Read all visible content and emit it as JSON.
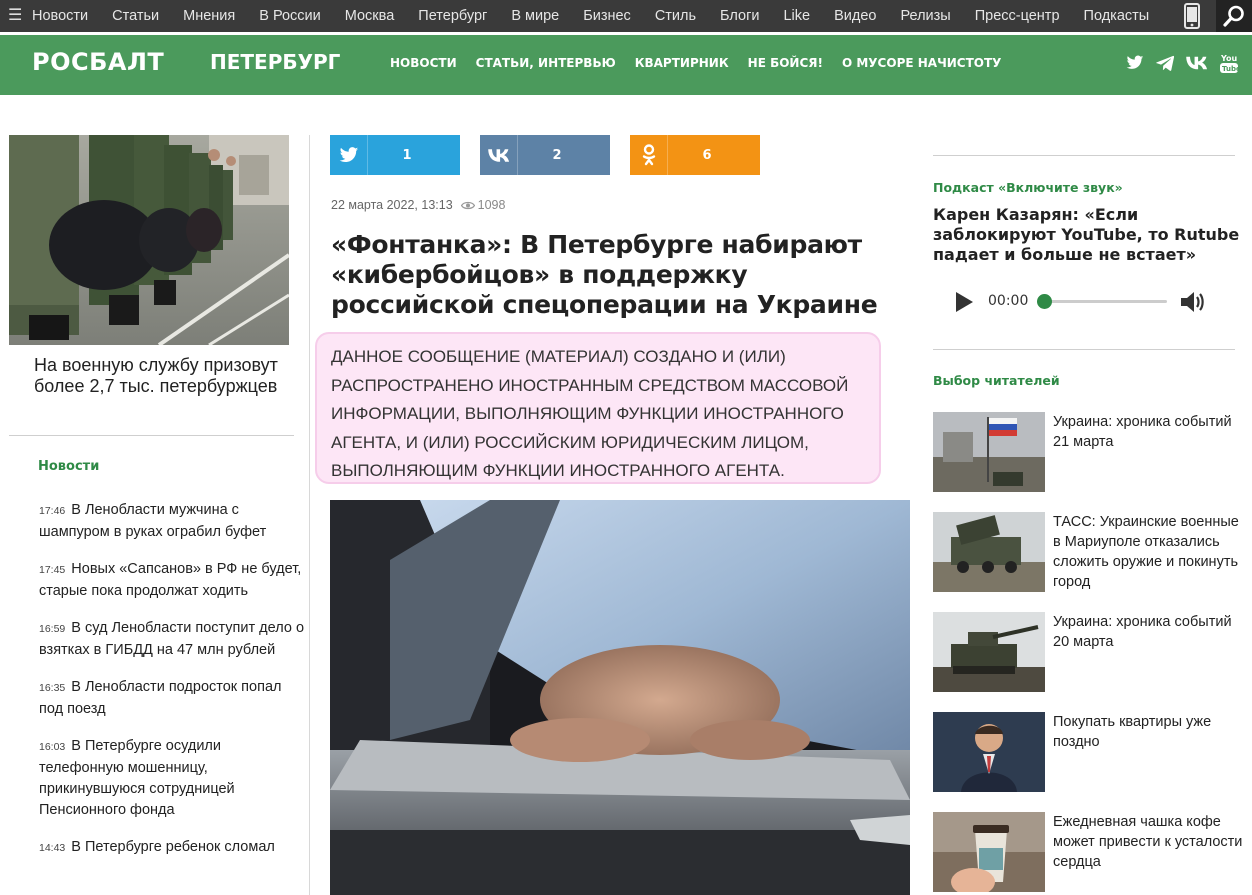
{
  "topnav": {
    "items": [
      "Новости",
      "Статьи",
      "Мнения",
      "В России",
      "Москва",
      "Петербург",
      "В мире",
      "Бизнес",
      "Стиль",
      "Блоги",
      "Like",
      "Видео",
      "Релизы",
      "Пресс-центр",
      "Подкасты"
    ]
  },
  "header": {
    "logo": "РОСБАЛТ",
    "city": "ПЕТЕРБУРГ",
    "sections": [
      "НОВОСТИ",
      "СТАТЬИ, ИНТЕРВЬЮ",
      "КВАРТИРНИК",
      "НЕ БОЙСЯ!",
      "О МУСОРЕ НАЧИСТОТУ"
    ],
    "socials": [
      "twitter-icon",
      "telegram-icon",
      "vk-icon",
      "youtube-icon"
    ]
  },
  "left": {
    "lead_title": "На военную службу призовут более 2,7 тыс. петербуржцев",
    "news_heading": "Новости",
    "news": [
      {
        "time": "17:46",
        "title": "В Ленобласти мужчина с шампуром в руках ограбил буфет"
      },
      {
        "time": "17:45",
        "title": "Новых «Сапсанов» в РФ не будет, старые пока продолжат ходить"
      },
      {
        "time": "16:59",
        "title": "В суд Ленобласти поступит дело о взятках в ГИБДД на 47 млн рублей"
      },
      {
        "time": "16:35",
        "title": "В Ленобласти подросток попал под поезд"
      },
      {
        "time": "16:03",
        "title": "В Петербурге осудили телефонную мошенницу, прикинувшуюся сотрудницей Пенсионного фонда"
      },
      {
        "time": "14:43",
        "title": "В Петербурге ребенок сломал"
      }
    ]
  },
  "article": {
    "share": {
      "twitter": "1",
      "vk": "2",
      "ok": "6"
    },
    "date": "22 марта 2022, 13:13",
    "views": "1098",
    "headline": "«Фонтанка»: В Петербурге набирают «кибербойцов» в поддержку российской спецоперации на Украине",
    "disclaimer": "ДАННОЕ СООБЩЕНИЕ (МАТЕРИАЛ) СОЗДАНО И (ИЛИ) РАСПРОСТРАНЕНО ИНОСТРАННЫМ СРЕДСТВОМ МАССОВОЙ ИНФОРМАЦИИ, ВЫПОЛНЯЮЩИМ ФУНКЦИИ ИНОСТРАННОГО АГЕНТА, И (ИЛИ) РОССИЙСКИМ ЮРИДИЧЕСКИМ ЛИЦОМ, ВЫПОЛНЯЮЩИМ ФУНКЦИИ ИНОСТРАННОГО АГЕНТА."
  },
  "right": {
    "podcast_tag": "Подкаст «Включите звук»",
    "podcast_title": "Карен Казарян: «Если заблокируют YouTube, то Rutube падает и больше не встает»",
    "player_time": "00:00",
    "player_progress": 0,
    "choice_heading": "Выбор читателей",
    "picks": [
      {
        "title": "Украина: хроника событий 21 марта"
      },
      {
        "title": "ТАСС: Украинские военные в Мариуполе отказались сложить оружие и покинуть город"
      },
      {
        "title": "Украина: хроника событий 20 марта"
      },
      {
        "title": "Покупать квартиры уже поздно"
      },
      {
        "title": "Ежедневная чашка кофе может привести к усталости сердца"
      }
    ]
  },
  "colors": {
    "brand_green": "#4b9a5c",
    "accent_green": "#2f8a46",
    "twitter": "#2aa3dc",
    "vk": "#5d82a6",
    "ok": "#f39314",
    "disclaimer_bg": "#fde6f6"
  }
}
